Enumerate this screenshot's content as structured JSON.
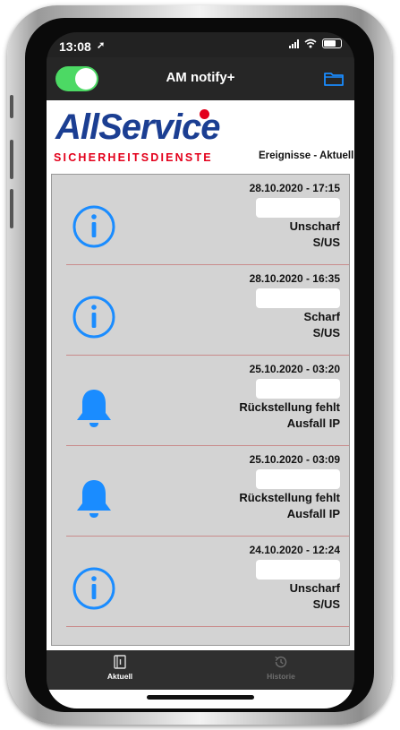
{
  "status_bar": {
    "time": "13:08"
  },
  "nav": {
    "title": "AM notify+",
    "toggle_on": true
  },
  "brand": {
    "name": "AllService",
    "subtitle": "SICHERHEITSDIENSTE"
  },
  "section": {
    "title": "Ereignisse - Aktuell"
  },
  "events": [
    {
      "timestamp": "28.10.2020 - 17:15",
      "status": "Unscharf",
      "code": "S/US",
      "icon": "info-icon"
    },
    {
      "timestamp": "28.10.2020 - 16:35",
      "status": "Scharf",
      "code": "S/US",
      "icon": "info-icon"
    },
    {
      "timestamp": "25.10.2020 - 03:20",
      "status": "Rückstellung fehlt",
      "code": "Ausfall IP",
      "icon": "bell-icon"
    },
    {
      "timestamp": "25.10.2020 - 03:09",
      "status": "Rückstellung fehlt",
      "code": "Ausfall IP",
      "icon": "bell-icon"
    },
    {
      "timestamp": "24.10.2020 - 12:24",
      "status": "Unscharf",
      "code": "S/US",
      "icon": "info-icon"
    }
  ],
  "tabs": [
    {
      "label": "Aktuell",
      "icon": "notebook-icon",
      "active": true
    },
    {
      "label": "Historie",
      "icon": "history-icon",
      "active": false
    }
  ],
  "colors": {
    "accent": "#1a8cff",
    "toggle": "#4cd964",
    "brand_blue": "#1b3e92",
    "brand_red": "#e3001b"
  }
}
